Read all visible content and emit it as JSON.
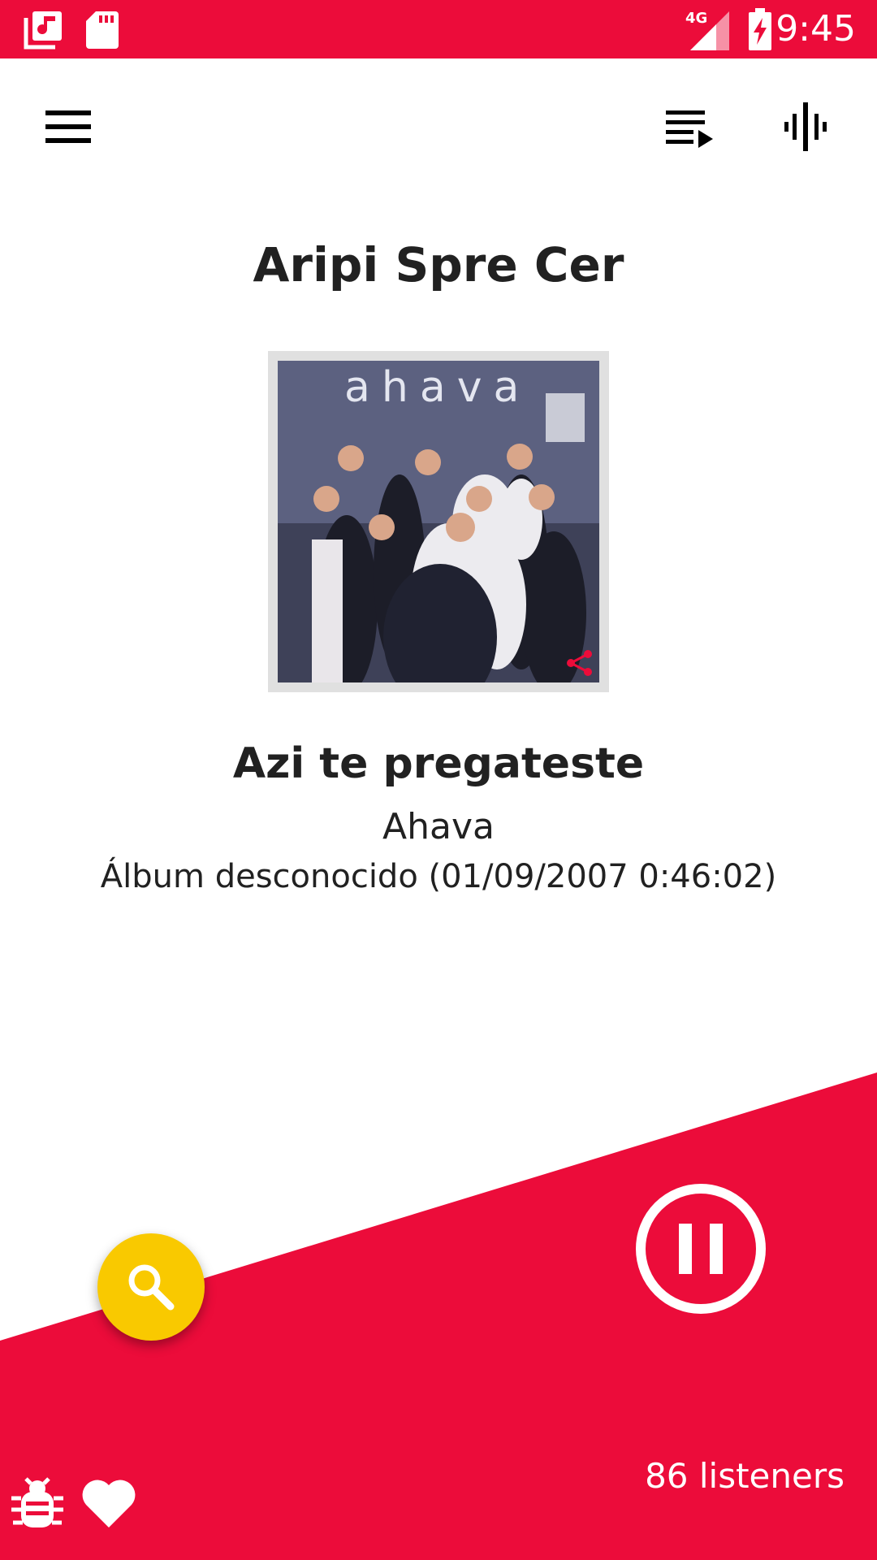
{
  "status_bar": {
    "time": "9:45",
    "network": "4G",
    "icons": [
      "music-library-icon",
      "sd-card-icon",
      "signal-icon",
      "battery-charging-icon"
    ]
  },
  "toolbar": {
    "icons": [
      "menu-icon",
      "playlist-icon",
      "equalizer-icon"
    ]
  },
  "station": {
    "name": "Aripi Spre Cer"
  },
  "cover_art": {
    "text": "ahava",
    "share_icon": "share-icon"
  },
  "now_playing": {
    "title": "Azi te pregateste",
    "artist": "Ahava",
    "album_info": "Álbum desconocido (01/09/2007 0:46:02)"
  },
  "player": {
    "state_icon": "pause-icon",
    "search_icon": "search-icon",
    "listeners": "86  listeners"
  },
  "bottom_icons": [
    "bug-icon",
    "heart-icon"
  ],
  "colors": {
    "accent": "#ec0c3a",
    "fab": "#f9c900",
    "text": "#212121",
    "background": "#ffffff"
  }
}
